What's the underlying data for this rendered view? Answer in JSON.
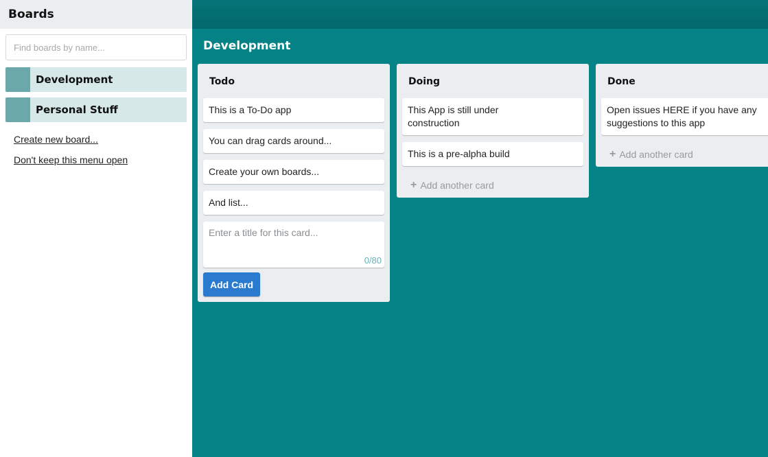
{
  "sidebar": {
    "title": "Boards",
    "search_placeholder": "Find boards by name...",
    "boards": [
      {
        "name": "Development"
      },
      {
        "name": "Personal Stuff"
      }
    ],
    "create_link": "Create new board...",
    "close_link": "Don't keep this menu open"
  },
  "board": {
    "title": "Development",
    "lists": [
      {
        "title": "Todo",
        "cards": [
          "This is a To-Do app",
          "You can drag cards around...",
          "Create your own boards...",
          "And list..."
        ],
        "composer_placeholder": "Enter a title for this card...",
        "composer_counter": "0/80",
        "add_button": "Add Card"
      },
      {
        "title": "Doing",
        "cards": [
          "This App is still under construction",
          "This is a pre-alpha build"
        ],
        "add_another": "Add another card"
      },
      {
        "title": "Done",
        "cards": [
          "Open issues HERE if you have any suggestions to this app"
        ],
        "add_another": "Add another card"
      }
    ]
  },
  "colors": {
    "background": "#058286",
    "topbar": "#03686c",
    "list_bg": "#ebeef0",
    "board_item_bg": "#d6e8e8",
    "board_swatch": "#6aa8aa",
    "add_button": "#2a7bd0"
  }
}
